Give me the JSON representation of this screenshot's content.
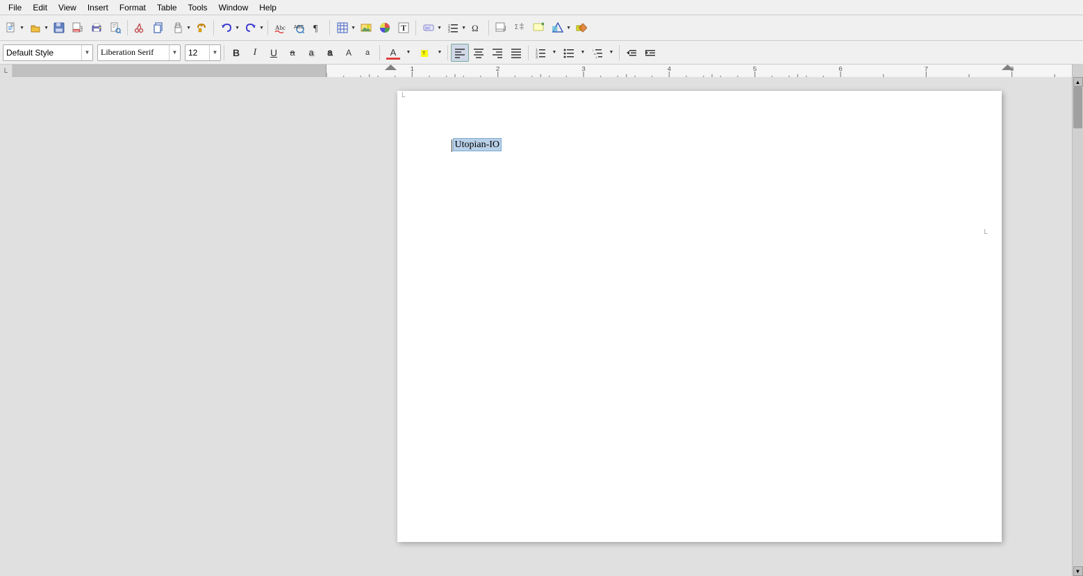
{
  "menubar": {
    "items": [
      "File",
      "Edit",
      "View",
      "Insert",
      "Format",
      "Table",
      "Tools",
      "Window",
      "Help"
    ]
  },
  "toolbar1": {
    "new_label": "New",
    "open_label": "Open",
    "save_label": "Save",
    "export_label": "Export",
    "print_label": "Print",
    "printpreview_label": "Print Preview",
    "cut_label": "Cut",
    "copy_label": "Copy",
    "paste_label": "Paste",
    "clone_label": "Clone",
    "undo_label": "Undo",
    "redo_label": "Redo",
    "spellauto_label": "Spell Check Auto",
    "spellcheck_label": "Spell Check",
    "formatting_label": "Formatting Marks",
    "table_label": "Insert Table",
    "frame_label": "Insert Frame",
    "chart_label": "Insert Chart",
    "text_label": "Insert Text",
    "field_label": "Insert Field",
    "numering_label": "Numbering",
    "special_label": "Special Characters",
    "footnote_label": "Footnote",
    "equation_label": "Equation",
    "anchor_label": "Anchor",
    "shapes_label": "Basic Shapes",
    "show_label": "Show Draw Functions"
  },
  "toolbar2": {
    "style_value": "Default Style",
    "font_value": "Liberation Serif",
    "size_value": "12",
    "bold_label": "Bold",
    "italic_label": "Italic",
    "underline_label": "Underline",
    "strike_label": "Strikethrough",
    "shadow_label": "Shadow",
    "outline_label": "Outline",
    "upper_label": "Uppercase",
    "lower_label": "Lowercase",
    "fontcolor_label": "Font Color",
    "highlight_label": "Highlighting Color",
    "align_left_label": "Align Left",
    "align_center_label": "Align Center",
    "align_right_label": "Align Right",
    "align_justify_label": "Justify",
    "list_num_label": "Ordered List",
    "list_bullet_label": "Unordered List",
    "list_outline_label": "List Outline",
    "indent_dec_label": "Decrease Indent",
    "indent_inc_label": "Increase Indent"
  },
  "document": {
    "content_text": "Utopian-IO",
    "selected": true
  },
  "ruler": {
    "left_marker": "L"
  },
  "page_corner_marker": "L"
}
